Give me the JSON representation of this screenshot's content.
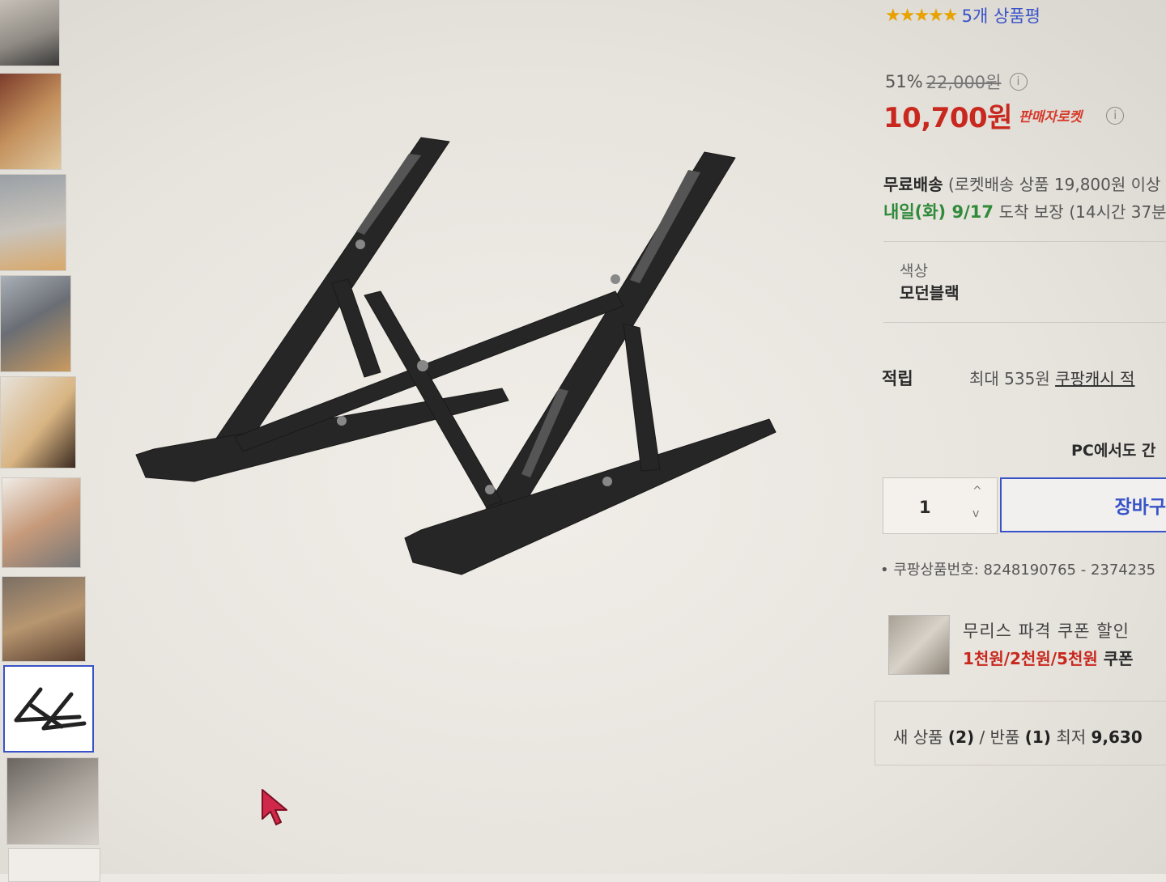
{
  "rating": {
    "stars": "★★★★★",
    "review_count": "5개 상품평",
    "value": 5
  },
  "price": {
    "discount_rate": "51%",
    "original_price": "22,000원",
    "sale_price": "10,700원",
    "seller_badge": "판매자로켓",
    "info_icon": "i"
  },
  "shipping": {
    "label": "무료배송",
    "condition": "(로켓배송 상품 19,800원 이상",
    "arrival_date": "내일(화) 9/17",
    "arrival_text": "도착 보장",
    "countdown": "(14시간 37분"
  },
  "option": {
    "label": "색상",
    "value": "모던블랙"
  },
  "reward": {
    "label": "적립",
    "text": "최대 535원",
    "link": "쿠팡캐시 적"
  },
  "pc_note": "PC에서도 간",
  "quantity": {
    "value": "1",
    "up_icon": "^",
    "down_icon": "v"
  },
  "cart_button": "장바구",
  "product_number": "쿠팡상품번호: 8248190765 - 2374235",
  "coupon": {
    "title": "무리스 파격 쿠폰 할인",
    "amounts": "1천원/2천원/5천원",
    "suffix": "쿠폰"
  },
  "offers": {
    "new_label": "새 상품",
    "new_count": "(2)",
    "return_label": "반품",
    "return_count": "(1)",
    "lowest_label": "최저",
    "lowest_price": "9,630"
  },
  "colors": {
    "accent_blue": "#3853c8",
    "price_red": "#c8281e",
    "arrival_green": "#2f8a3a",
    "star_gold": "#e8a200",
    "cursor_red": "#d0284a"
  }
}
